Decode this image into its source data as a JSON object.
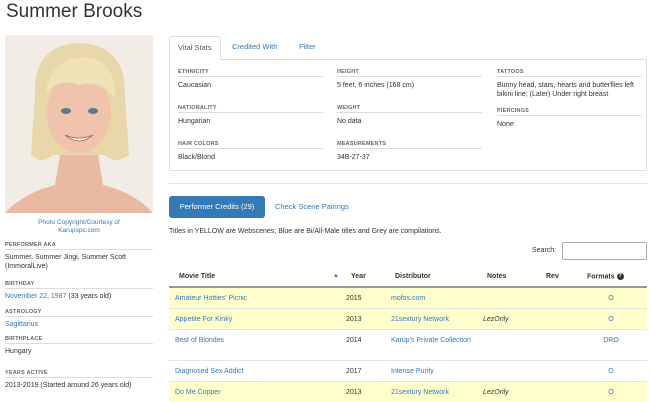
{
  "page": {
    "title": "Summer Brooks"
  },
  "photo": {
    "caption_line1": "Photo Copyright/Courtesy of",
    "caption_line2": "Karupspc.com"
  },
  "sidebar": [
    {
      "heading": "PERFORMER AKA",
      "value": "Summer, Summer Jingi, Summer Scott (ImmoralLive)"
    },
    {
      "heading": "BIRTHDAY",
      "link": "November 22, 1987",
      "value": " (33 years old)"
    },
    {
      "heading": "ASTROLOGY",
      "link": "Sagittarius"
    },
    {
      "heading": "BIRTHPLACE",
      "value": "Hungary"
    },
    {
      "heading": "YEARS ACTIVE",
      "value": "2013-2019 (Started around 26 years old)"
    }
  ],
  "tabs": [
    {
      "label": "Vital Stats",
      "active": true
    },
    {
      "label": "Credited With",
      "active": false
    },
    {
      "label": "Filter",
      "active": false
    }
  ],
  "vital_stats": {
    "col1": [
      {
        "heading": "ETHNICITY",
        "value": "Caucasian"
      },
      {
        "heading": "NATIONALITY",
        "value": "Hungarian"
      },
      {
        "heading": "HAIR COLORS",
        "value": "Black/Blond"
      }
    ],
    "col2": [
      {
        "heading": "HEIGHT",
        "value": "5 feet, 6 inches (168 cm)"
      },
      {
        "heading": "WEIGHT",
        "value": "No data"
      },
      {
        "heading": "MEASUREMENTS",
        "value": "34B-27-37"
      }
    ],
    "col3": [
      {
        "heading": "TATTOOS",
        "value": "Bunny head, stars, hearts and butterflies left bikini line; (Later) Under right breast"
      },
      {
        "heading": "PIERCINGS",
        "value": "None"
      }
    ]
  },
  "credits": {
    "button_label": "Performer Credits (29)",
    "pairings_label": "Check Scene Pairings",
    "legend_note": "Titles in YELLOW are Webscenes; Blue are Bi/All-Male titles and Grey are compilations.",
    "search_label": "Search:",
    "search_value": ""
  },
  "table": {
    "columns": [
      "Movie Title",
      "Year",
      "Distributor",
      "Notes",
      "Rev",
      "Formats"
    ],
    "rows": [
      {
        "title": "Amateur Hotties' Picnic",
        "year": "2015",
        "distributor": "mofos.com",
        "notes": "",
        "rev": "",
        "formats": "O",
        "color": "yellow"
      },
      {
        "title": "Appetite For Kinky",
        "year": "2013",
        "distributor": "21sextury Network",
        "notes": "LezOnly",
        "rev": "",
        "formats": "O",
        "color": "yellow"
      },
      {
        "title": "Best of Blondes",
        "year": "2014",
        "distributor": "Karup's Private Collection",
        "notes": "",
        "rev": "",
        "formats": "DRO",
        "color": "white"
      },
      {
        "title": "Diagnosed Sex Addict",
        "year": "2017",
        "distributor": "Intense Purity",
        "notes": "",
        "rev": "",
        "formats": "O",
        "color": "white"
      },
      {
        "title": "Do Me Copper",
        "year": "2013",
        "distributor": "21sextury Network",
        "notes": "LezOnly",
        "rev": "",
        "formats": "O",
        "color": "yellow"
      }
    ]
  },
  "colors": {
    "link": "#337ab7",
    "webscene_row": "#ffffcc",
    "button": "#337ab7"
  }
}
